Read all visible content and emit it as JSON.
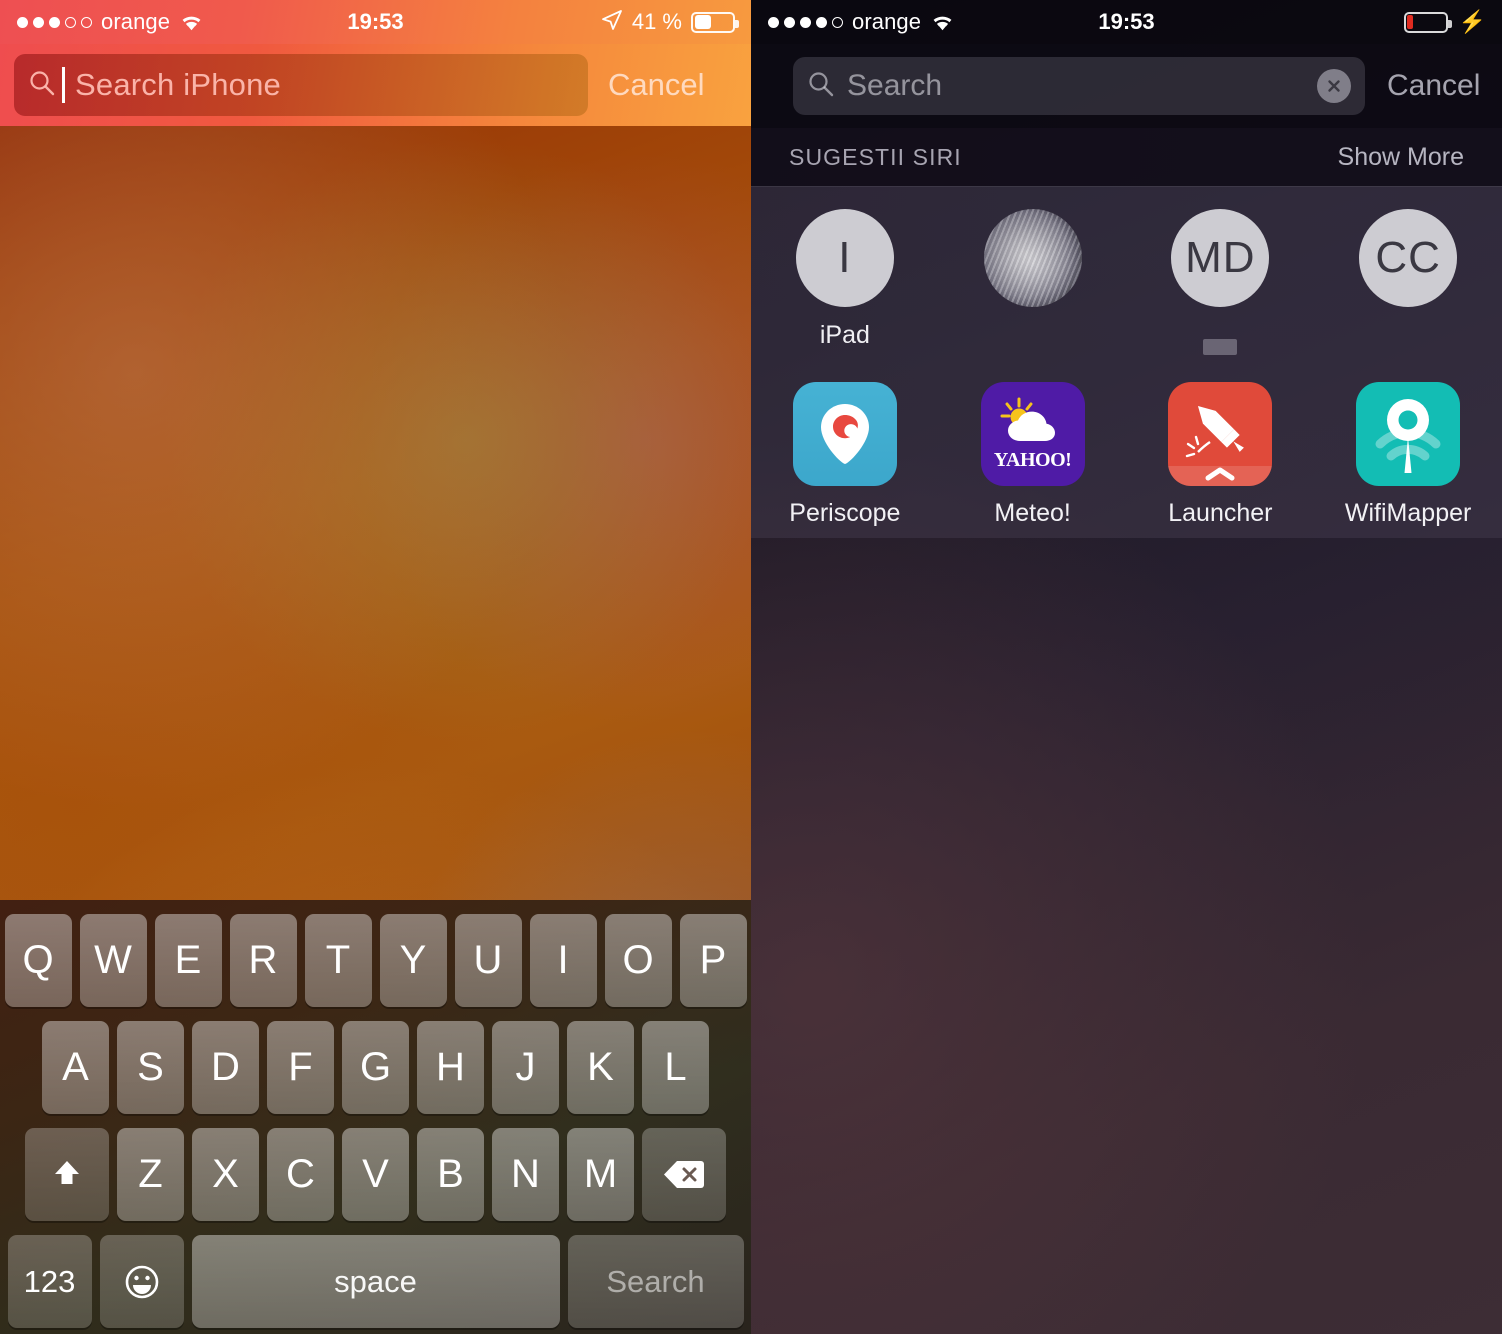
{
  "left": {
    "status": {
      "signal_filled": 3,
      "signal_total": 5,
      "carrier": "orange",
      "wifi_icon": "wifi-icon",
      "time": "19:53",
      "location_icon": "location-arrow-icon",
      "battery_percent": "41 %",
      "battery_level": 41
    },
    "search": {
      "placeholder": "Search iPhone",
      "value": "",
      "magnifier_icon": "search-icon",
      "cancel_label": "Cancel"
    },
    "keyboard": {
      "row1": [
        "Q",
        "W",
        "E",
        "R",
        "T",
        "Y",
        "U",
        "I",
        "O",
        "P"
      ],
      "row2": [
        "A",
        "S",
        "D",
        "F",
        "G",
        "H",
        "J",
        "K",
        "L"
      ],
      "row3": [
        "Z",
        "X",
        "C",
        "V",
        "B",
        "N",
        "M"
      ],
      "shift_icon": "shift-arrow-icon",
      "backspace_icon": "backspace-icon",
      "numbers_label": "123",
      "emoji_icon": "emoji-smiley-icon",
      "space_label": "space",
      "search_label": "Search"
    }
  },
  "right": {
    "status": {
      "signal_filled": 4,
      "signal_total": 5,
      "carrier": "orange",
      "wifi_icon": "wifi-icon",
      "time": "19:53",
      "battery_level": 6,
      "charging_icon": "lightning-bolt-icon"
    },
    "search": {
      "placeholder": "Search",
      "value": "",
      "magnifier_icon": "search-icon",
      "clear_icon": "clear-circle-x-icon",
      "cancel_label": "Cancel"
    },
    "suggestions": {
      "section_title": "SUGESTII SIRI",
      "show_more_label": "Show More",
      "contacts": [
        {
          "initials": "I",
          "label": "iPad",
          "avatar_type": "initials"
        },
        {
          "initials": "",
          "label": "",
          "avatar_type": "photo"
        },
        {
          "initials": "MD",
          "label": "",
          "avatar_type": "initials",
          "label_redacted": true
        },
        {
          "initials": "CC",
          "label": "",
          "avatar_type": "initials"
        }
      ],
      "apps": [
        {
          "name": "Periscope",
          "icon": "periscope-icon",
          "color": "#3ca7cb"
        },
        {
          "name": "Meteo!",
          "icon": "yahoo-weather-icon",
          "color": "#4f1ba6",
          "wordmark": "YAHOO!"
        },
        {
          "name": "Launcher",
          "icon": "launcher-rocket-icon",
          "color": "#e04a3a"
        },
        {
          "name": "WifiMapper",
          "icon": "wifimapper-pin-icon",
          "color": "#13bdb4"
        }
      ]
    }
  }
}
